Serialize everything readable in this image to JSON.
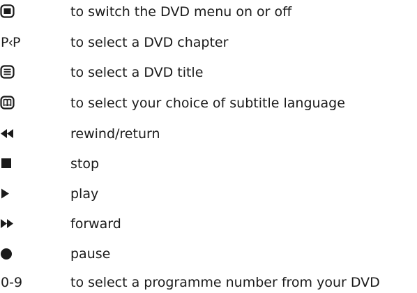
{
  "rows": [
    {
      "icon": "menu-toggle-icon",
      "symbol": "",
      "text": "to switch the DVD menu on or off"
    },
    {
      "icon": "chapter-select-icon",
      "symbol": "P‹P",
      "text": "to select a DVD chapter"
    },
    {
      "icon": "title-select-icon",
      "symbol": "",
      "text": "to select a DVD title"
    },
    {
      "icon": "subtitle-icon",
      "symbol": "",
      "text": "to select your choice of subtitle language"
    },
    {
      "icon": "rewind-icon",
      "symbol": "",
      "text": "rewind/return"
    },
    {
      "icon": "stop-icon",
      "symbol": "",
      "text": "stop"
    },
    {
      "icon": "play-icon",
      "symbol": "",
      "text": "play"
    },
    {
      "icon": "forward-icon",
      "symbol": "",
      "text": "forward"
    },
    {
      "icon": "pause-icon",
      "symbol": "",
      "text": "pause"
    },
    {
      "icon": "number-keys-icon",
      "symbol": "0-9",
      "text": "to select a programme number from your DVD"
    }
  ]
}
